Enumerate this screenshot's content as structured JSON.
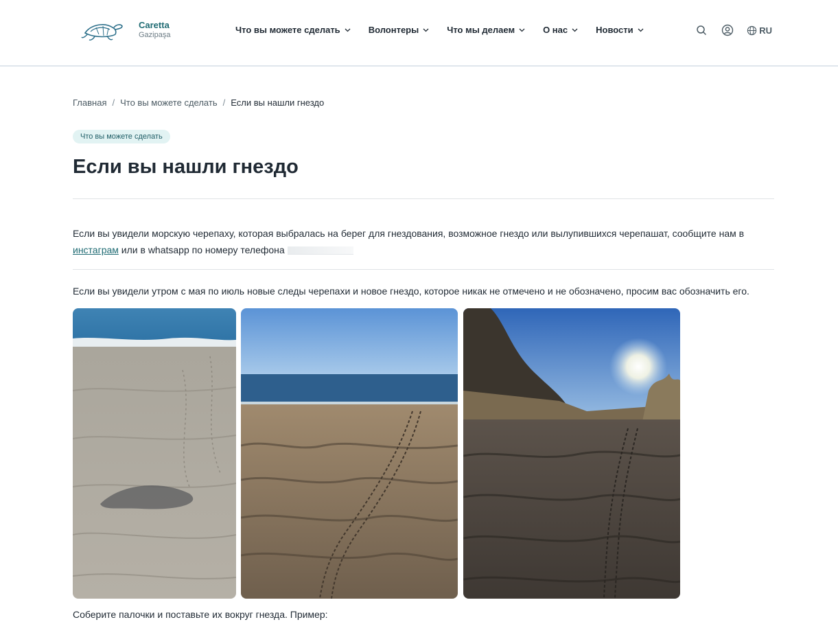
{
  "header": {
    "logo_title": "Caretta",
    "logo_subtitle": "Gazipaşa",
    "nav": [
      {
        "label": "Что вы можете сделать"
      },
      {
        "label": "Волонтеры"
      },
      {
        "label": "Что мы делаем"
      },
      {
        "label": "О нас"
      },
      {
        "label": "Новости"
      }
    ],
    "search_icon": "search-icon",
    "account_icon": "user-icon",
    "language": "RU"
  },
  "breadcrumb": {
    "home": "Главная",
    "section": "Что вы можете сделать",
    "current": "Если вы нашли гнездо"
  },
  "badge": "Что вы можете сделать",
  "title": "Если вы нашли гнездо",
  "para1": {
    "text_before": "Если вы увидели морскую черепаху, которая выбралась на берег для гнездования, возможное гнездо или вылупившихся черепашат, сообщите нам в ",
    "link": "инстаграм",
    "text_after": " или в whatsapp по номеру телефона"
  },
  "para2": "Если вы увидели утром с мая по июль новые следы черепахи и новое гнездо, которое никак не отмечено и не обозначено, просим вас обозначить его.",
  "para3": "Соберите палочки и поставьте их вокруг гнезда. Пример:",
  "colors": {
    "accent": "#1f6b73",
    "badge_bg": "#e2f3f3",
    "text": "#1f2933"
  }
}
